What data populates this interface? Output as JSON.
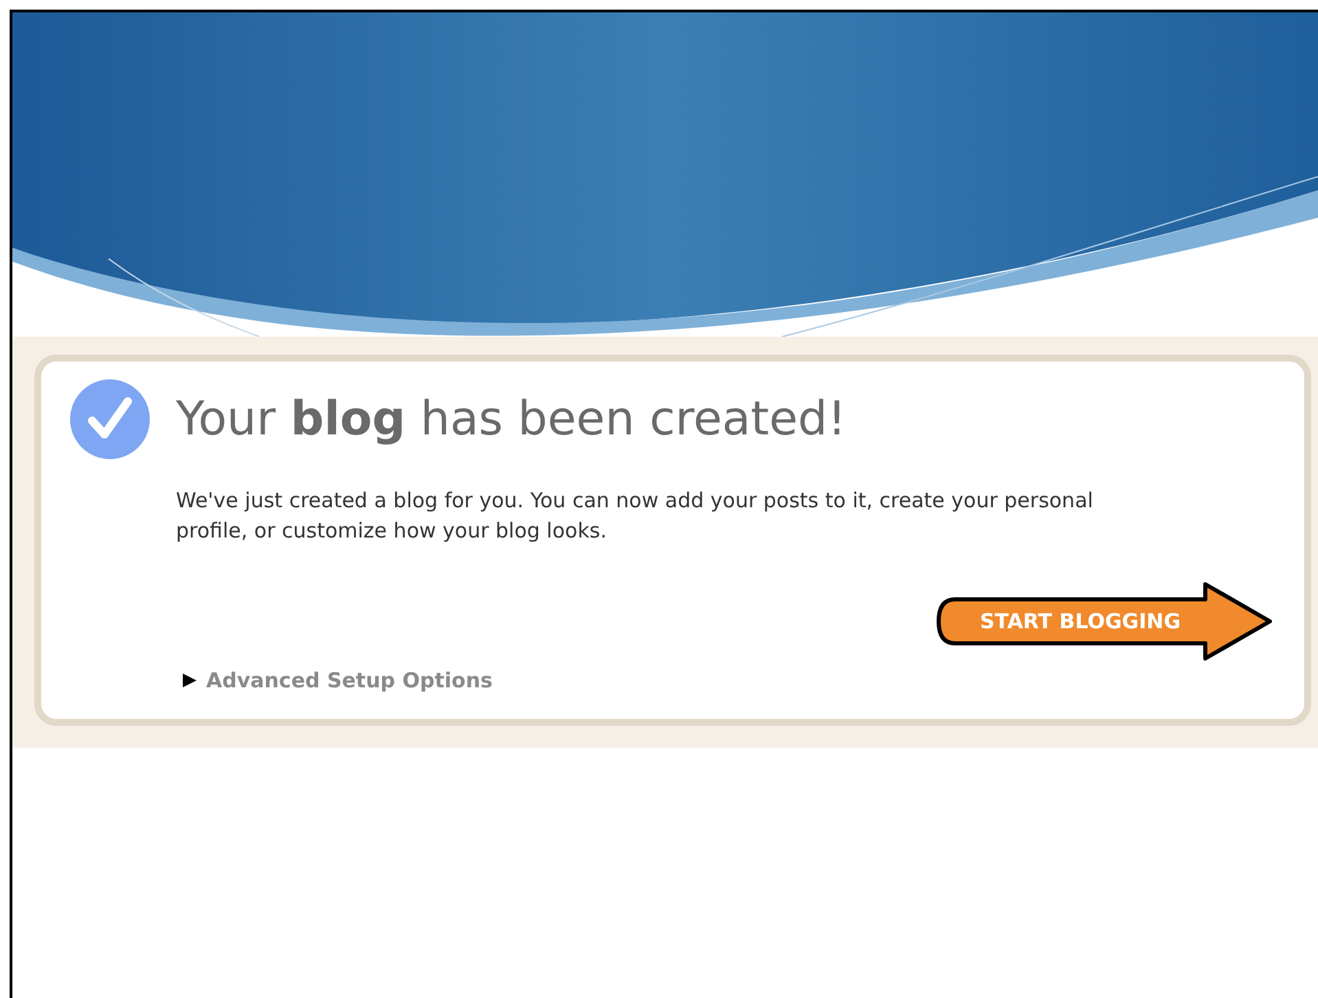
{
  "message": {
    "title": "Your **blog** has been created!",
    "body": "We've just created a blog for you. You can now add your posts to it, create your personal profile, or customize how your blog looks.",
    "button": "START BLOGGING",
    "advanced": {
      "label": "Advanced Setup Options",
      "expanded": false
    }
  }
}
